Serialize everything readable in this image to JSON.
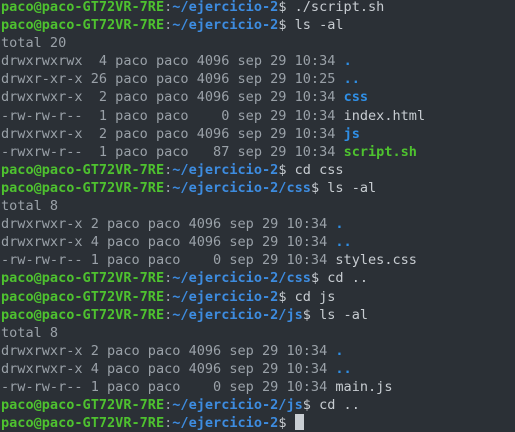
{
  "prompt": {
    "user": "paco@paco-GT72VR-7RE",
    "sep": ":",
    "dollar": "$"
  },
  "lines": [
    {
      "kind": "prompt",
      "path": "~/ejercicio-2",
      "cmd": " ./script.sh"
    },
    {
      "kind": "prompt",
      "path": "~/ejercicio-2",
      "cmd": " ls -al"
    },
    {
      "kind": "text",
      "text": "total 20"
    },
    {
      "kind": "entry",
      "meta": "drwxrwxrwx  4 paco paco 4096 sep 29 10:34 ",
      "name": ".",
      "style": "dir"
    },
    {
      "kind": "entry",
      "meta": "drwxr-xr-x 26 paco paco 4096 sep 29 10:25 ",
      "name": "..",
      "style": "dir"
    },
    {
      "kind": "entry",
      "meta": "drwxrwxr-x  2 paco paco 4096 sep 29 10:34 ",
      "name": "css",
      "style": "dir"
    },
    {
      "kind": "entry",
      "meta": "-rw-rw-r--  1 paco paco    0 sep 29 10:34 ",
      "name": "index.html",
      "style": "txt"
    },
    {
      "kind": "entry",
      "meta": "drwxrwxr-x  2 paco paco 4096 sep 29 10:34 ",
      "name": "js",
      "style": "dir"
    },
    {
      "kind": "entry",
      "meta": "-rwxrw-r--  1 paco paco   87 sep 29 10:34 ",
      "name": "script.sh",
      "style": "exe"
    },
    {
      "kind": "prompt",
      "path": "~/ejercicio-2",
      "cmd": " cd css"
    },
    {
      "kind": "prompt",
      "path": "~/ejercicio-2/css",
      "cmd": " ls -al"
    },
    {
      "kind": "text",
      "text": "total 8"
    },
    {
      "kind": "entry",
      "meta": "drwxrwxr-x 2 paco paco 4096 sep 29 10:34 ",
      "name": ".",
      "style": "dir"
    },
    {
      "kind": "entry",
      "meta": "drwxrwxr-x 4 paco paco 4096 sep 29 10:34 ",
      "name": "..",
      "style": "dir"
    },
    {
      "kind": "entry",
      "meta": "-rw-rw-r-- 1 paco paco    0 sep 29 10:34 ",
      "name": "styles.css",
      "style": "txt"
    },
    {
      "kind": "prompt",
      "path": "~/ejercicio-2/css",
      "cmd": " cd .."
    },
    {
      "kind": "prompt",
      "path": "~/ejercicio-2",
      "cmd": " cd js"
    },
    {
      "kind": "prompt",
      "path": "~/ejercicio-2/js",
      "cmd": " ls -al"
    },
    {
      "kind": "text",
      "text": "total 8"
    },
    {
      "kind": "entry",
      "meta": "drwxrwxr-x 2 paco paco 4096 sep 29 10:34 ",
      "name": ".",
      "style": "dir"
    },
    {
      "kind": "entry",
      "meta": "drwxrwxr-x 4 paco paco 4096 sep 29 10:34 ",
      "name": "..",
      "style": "dir"
    },
    {
      "kind": "entry",
      "meta": "-rw-rw-r-- 1 paco paco    0 sep 29 10:34 ",
      "name": "main.js",
      "style": "txt"
    },
    {
      "kind": "prompt",
      "path": "~/ejercicio-2/js",
      "cmd": " cd .."
    },
    {
      "kind": "prompt",
      "path": "~/ejercicio-2",
      "cmd": " ",
      "cursor": true
    }
  ]
}
